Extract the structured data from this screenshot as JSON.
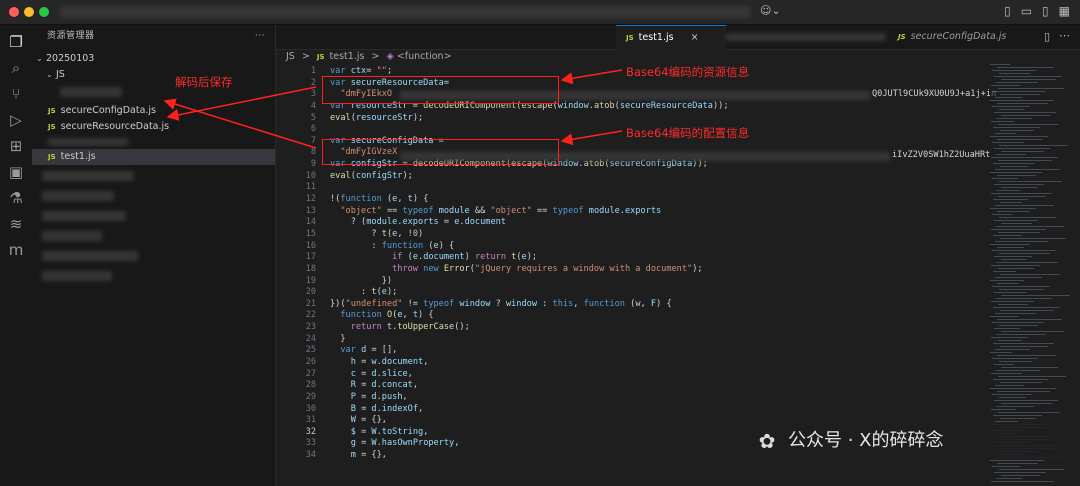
{
  "sidebar": {
    "title": "资源管理器",
    "more_label": "···",
    "folder_root": "20250103",
    "folder_js": "JS",
    "files": [
      "secureConfigData.js",
      "secureResourceData.js",
      "test1.js"
    ],
    "selected_file": "test1.js"
  },
  "annotations": {
    "save_note": "解码后保存",
    "resource_note": "Base64编码的资源信息",
    "config_note": "Base64编码的配置信息"
  },
  "tabs": [
    {
      "label": "test1.js",
      "badge": "JS",
      "active": true,
      "close": "×"
    },
    {
      "label": "secureConfigData.js",
      "badge": "JS",
      "active": false
    }
  ],
  "breadcrumb": {
    "folder": "JS",
    "sep": ">",
    "file": "test1.js",
    "symbol": "<function>"
  },
  "editor": {
    "lines": [
      {
        "n": "1",
        "segs": [
          [
            "kw",
            "var "
          ],
          [
            "var",
            "ctx"
          ],
          [
            "",
            "= "
          ],
          [
            "str",
            "\"\""
          ],
          [
            "",
            ";"
          ]
        ]
      },
      {
        "n": "2",
        "segs": [
          [
            "kw",
            "var "
          ],
          [
            "var",
            "secureResourceData"
          ],
          [
            "",
            ""
          ],
          [
            "",
            "= "
          ]
        ]
      },
      {
        "n": "3",
        "segs": [
          [
            "",
            "  "
          ],
          [
            "str",
            "\"dmFyIEkxO"
          ]
        ]
      },
      {
        "n": "4",
        "segs": [
          [
            "kw",
            "var "
          ],
          [
            "var",
            "resourceStr"
          ],
          [
            "",
            " = "
          ],
          [
            "fn",
            "decodeURIComponent"
          ],
          [
            "",
            "("
          ],
          [
            "fn",
            "escape"
          ],
          [
            "",
            "("
          ],
          [
            "var",
            "window"
          ],
          [
            "",
            "."
          ],
          [
            "fn",
            "atob"
          ],
          [
            "",
            "("
          ],
          [
            "var",
            "secureResourceData"
          ],
          [
            "",
            "));"
          ]
        ]
      },
      {
        "n": "5",
        "segs": [
          [
            "fn",
            "eval"
          ],
          [
            "",
            "("
          ],
          [
            "var",
            "resourceStr"
          ],
          [
            "",
            ");"
          ]
        ]
      },
      {
        "n": "6",
        "segs": []
      },
      {
        "n": "7",
        "segs": [
          [
            "kw",
            "var "
          ],
          [
            "var",
            "secureConfigData"
          ],
          [
            "",
            " = "
          ]
        ]
      },
      {
        "n": "8",
        "segs": [
          [
            "",
            "  "
          ],
          [
            "str",
            "\"dmFyIGVzeX"
          ]
        ]
      },
      {
        "n": "9",
        "segs": [
          [
            "kw",
            "var "
          ],
          [
            "var",
            "configStr"
          ],
          [
            "",
            " = "
          ],
          [
            "fn",
            "decodeURIComponent"
          ],
          [
            "",
            "("
          ],
          [
            "fn",
            "escape"
          ],
          [
            "",
            "("
          ],
          [
            "var",
            "window"
          ],
          [
            "",
            "."
          ],
          [
            "fn",
            "atob"
          ],
          [
            "",
            "("
          ],
          [
            "var",
            "secureConfigData"
          ],
          [
            "",
            "));"
          ]
        ]
      },
      {
        "n": "10",
        "segs": [
          [
            "fn",
            "eval"
          ],
          [
            "",
            "("
          ],
          [
            "var",
            "configStr"
          ],
          [
            "",
            ");"
          ]
        ]
      },
      {
        "n": "11",
        "segs": []
      },
      {
        "n": "12",
        "segs": [
          [
            "",
            "!("
          ],
          [
            "kw",
            "function "
          ],
          [
            "",
            "("
          ],
          [
            "var",
            "e"
          ],
          [
            "",
            ", "
          ],
          [
            "var",
            "t"
          ],
          [
            "",
            ") {"
          ]
        ]
      },
      {
        "n": "13",
        "segs": [
          [
            "",
            "  "
          ],
          [
            "str",
            "\"object\""
          ],
          [
            "",
            " == "
          ],
          [
            "kw",
            "typeof "
          ],
          [
            "var",
            "module"
          ],
          [
            "",
            " && "
          ],
          [
            "str",
            "\"object\""
          ],
          [
            "",
            " == "
          ],
          [
            "kw",
            "typeof "
          ],
          [
            "var",
            "module"
          ],
          [
            "",
            "."
          ],
          [
            "var",
            "exports"
          ]
        ]
      },
      {
        "n": "14",
        "segs": [
          [
            "",
            "    ? ("
          ],
          [
            "var",
            "module"
          ],
          [
            "",
            "."
          ],
          [
            "var",
            "exports"
          ],
          [
            "",
            " = "
          ],
          [
            "var",
            "e"
          ],
          [
            "",
            "."
          ],
          [
            "var",
            "document"
          ]
        ]
      },
      {
        "n": "15",
        "segs": [
          [
            "",
            "        ? "
          ],
          [
            "fn",
            "t"
          ],
          [
            "",
            "("
          ],
          [
            "var",
            "e"
          ],
          [
            "",
            ", !"
          ],
          [
            "num",
            "0"
          ],
          [
            "",
            ")"
          ]
        ]
      },
      {
        "n": "16",
        "segs": [
          [
            "",
            "        : "
          ],
          [
            "kw",
            "function "
          ],
          [
            "",
            "("
          ],
          [
            "var",
            "e"
          ],
          [
            "",
            ") {"
          ]
        ]
      },
      {
        "n": "17",
        "segs": [
          [
            "",
            "            "
          ],
          [
            "kw2",
            "if "
          ],
          [
            "",
            "("
          ],
          [
            "var",
            "e"
          ],
          [
            "",
            "."
          ],
          [
            "var",
            "document"
          ],
          [
            "",
            ") "
          ],
          [
            "kw2",
            "return "
          ],
          [
            "fn",
            "t"
          ],
          [
            "",
            "("
          ],
          [
            "var",
            "e"
          ],
          [
            "",
            ");"
          ]
        ]
      },
      {
        "n": "18",
        "segs": [
          [
            "",
            "            "
          ],
          [
            "kw2",
            "throw "
          ],
          [
            "kw",
            "new "
          ],
          [
            "fn",
            "Error"
          ],
          [
            "",
            "("
          ],
          [
            "str",
            "\"jQuery requires a window with a document\""
          ],
          [
            "",
            ");"
          ]
        ]
      },
      {
        "n": "19",
        "segs": [
          [
            "",
            "          })"
          ]
        ]
      },
      {
        "n": "20",
        "segs": [
          [
            "",
            "      : "
          ],
          [
            "fn",
            "t"
          ],
          [
            "",
            "("
          ],
          [
            "var",
            "e"
          ],
          [
            "",
            ");"
          ]
        ]
      },
      {
        "n": "21",
        "segs": [
          [
            "",
            "})("
          ],
          [
            "str",
            "\"undefined\""
          ],
          [
            "",
            " != "
          ],
          [
            "kw",
            "typeof "
          ],
          [
            "var",
            "window"
          ],
          [
            "",
            " ? "
          ],
          [
            "var",
            "window"
          ],
          [
            "",
            " : "
          ],
          [
            "kw",
            "this"
          ],
          [
            "",
            ", "
          ],
          [
            "kw",
            "function "
          ],
          [
            "",
            "("
          ],
          [
            "var",
            "w"
          ],
          [
            "",
            ", "
          ],
          [
            "var",
            "F"
          ],
          [
            "",
            ") {"
          ]
        ]
      },
      {
        "n": "22",
        "segs": [
          [
            "",
            "  "
          ],
          [
            "kw",
            "function "
          ],
          [
            "fn",
            "O"
          ],
          [
            "",
            "("
          ],
          [
            "var",
            "e"
          ],
          [
            "",
            ", "
          ],
          [
            "var",
            "t"
          ],
          [
            "",
            ") {"
          ]
        ]
      },
      {
        "n": "23",
        "segs": [
          [
            "",
            "    "
          ],
          [
            "kw2",
            "return "
          ],
          [
            "var",
            "t"
          ],
          [
            "",
            "."
          ],
          [
            "fn",
            "toUpperCase"
          ],
          [
            "",
            "();"
          ]
        ]
      },
      {
        "n": "24",
        "segs": [
          [
            "",
            "  }"
          ]
        ]
      },
      {
        "n": "25",
        "segs": [
          [
            "",
            "  "
          ],
          [
            "kw",
            "var "
          ],
          [
            "var",
            "d"
          ],
          [
            "",
            " = [],"
          ]
        ]
      },
      {
        "n": "26",
        "segs": [
          [
            "",
            "    "
          ],
          [
            "var",
            "h"
          ],
          [
            "",
            " = "
          ],
          [
            "var",
            "w"
          ],
          [
            "",
            "."
          ],
          [
            "var",
            "document"
          ],
          [
            "",
            ","
          ]
        ]
      },
      {
        "n": "27",
        "segs": [
          [
            "",
            "    "
          ],
          [
            "var",
            "c"
          ],
          [
            "",
            " = "
          ],
          [
            "var",
            "d"
          ],
          [
            "",
            "."
          ],
          [
            "var",
            "slice"
          ],
          [
            "",
            ","
          ]
        ]
      },
      {
        "n": "28",
        "segs": [
          [
            "",
            "    "
          ],
          [
            "var",
            "R"
          ],
          [
            "",
            " = "
          ],
          [
            "var",
            "d"
          ],
          [
            "",
            "."
          ],
          [
            "var",
            "concat"
          ],
          [
            "",
            ","
          ]
        ]
      },
      {
        "n": "29",
        "segs": [
          [
            "",
            "    "
          ],
          [
            "var",
            "P"
          ],
          [
            "",
            " = "
          ],
          [
            "var",
            "d"
          ],
          [
            "",
            "."
          ],
          [
            "var",
            "push"
          ],
          [
            "",
            ","
          ]
        ]
      },
      {
        "n": "30",
        "segs": [
          [
            "",
            "    "
          ],
          [
            "var",
            "B"
          ],
          [
            "",
            " = "
          ],
          [
            "var",
            "d"
          ],
          [
            "",
            "."
          ],
          [
            "var",
            "indexOf"
          ],
          [
            "",
            ","
          ]
        ]
      },
      {
        "n": "31",
        "segs": [
          [
            "",
            "    "
          ],
          [
            "var",
            "W"
          ],
          [
            "",
            " = {},"
          ]
        ]
      },
      {
        "n": "32",
        "segs": [
          [
            "",
            "    "
          ],
          [
            "var",
            "$"
          ],
          [
            "",
            " = "
          ],
          [
            "var",
            "W"
          ],
          [
            "",
            "."
          ],
          [
            "var",
            "toString"
          ],
          [
            "",
            ","
          ]
        ]
      },
      {
        "n": "33",
        "segs": [
          [
            "",
            "    "
          ],
          [
            "var",
            "g"
          ],
          [
            "",
            " = "
          ],
          [
            "var",
            "W"
          ],
          [
            "",
            "."
          ],
          [
            "var",
            "hasOwnProperty"
          ],
          [
            "",
            ","
          ]
        ]
      },
      {
        "n": "34",
        "segs": [
          [
            "",
            "    "
          ],
          [
            "var",
            "m"
          ],
          [
            "",
            " = {},"
          ]
        ]
      }
    ],
    "current_line": "32",
    "line3_tail": "Q0JUTl9CUk9XU0U9J+a1j+in",
    "line8_tail": "iIvZ2V0SW1hZ2UuaHRt"
  },
  "watermark": {
    "logo": "✿",
    "text": "公众号 · X的碎碎念"
  },
  "colors": {
    "annotation": "#ff2b2b",
    "accent": "#0078d4"
  }
}
